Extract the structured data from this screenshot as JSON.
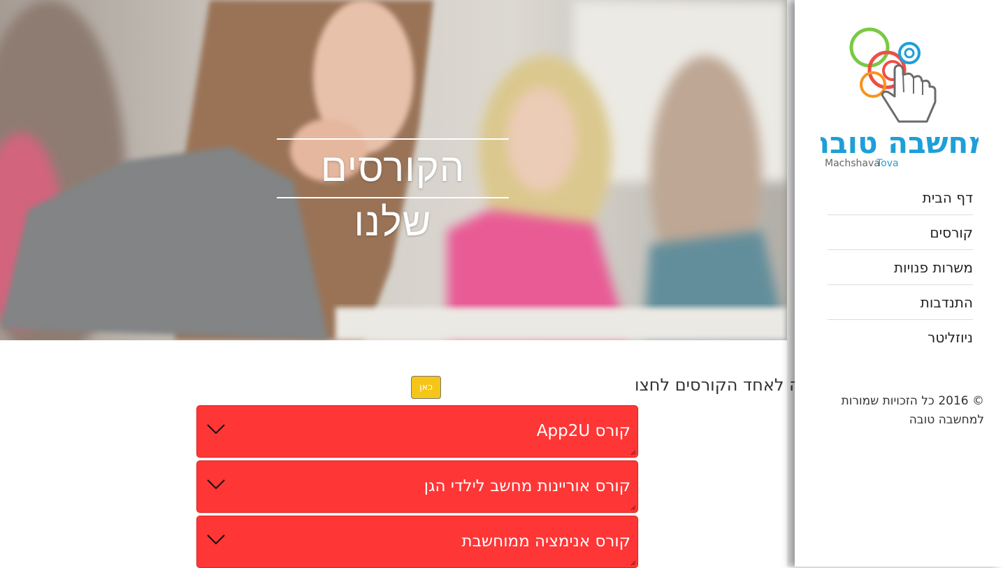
{
  "hero": {
    "title": "הקורסים שלנו"
  },
  "registration": {
    "text": "להרשמה לאחד הקורסים לחצו",
    "button_label": "כאן"
  },
  "courses": [
    {
      "label": "קורס App2U"
    },
    {
      "label": "קורס אוריינות מחשב לילדי הגן"
    },
    {
      "label": "קורס אנימציה ממוחשבת"
    }
  ],
  "sidebar": {
    "logo": {
      "text_hebrew": "מחשבה טובה",
      "text_english_1": "Machshava",
      "text_english_2": "Tova",
      "icon": "pointer-hand-circles-logo"
    },
    "nav": [
      {
        "label": "דף הבית"
      },
      {
        "label": "קורסים"
      },
      {
        "label": "משרות פנויות"
      },
      {
        "label": "התנדבות"
      },
      {
        "label": "ניוזליטר"
      }
    ],
    "copyright_line1": "© 2016 כל הזכויות שמורות",
    "copyright_line2": "למחשבה טובה"
  },
  "colors": {
    "course_red": "#ff3636",
    "button_yellow": "#f5c518",
    "logo_blue": "#1e9fd8",
    "logo_green": "#7ac943",
    "logo_red": "#f04e45",
    "logo_orange": "#f7941d"
  }
}
